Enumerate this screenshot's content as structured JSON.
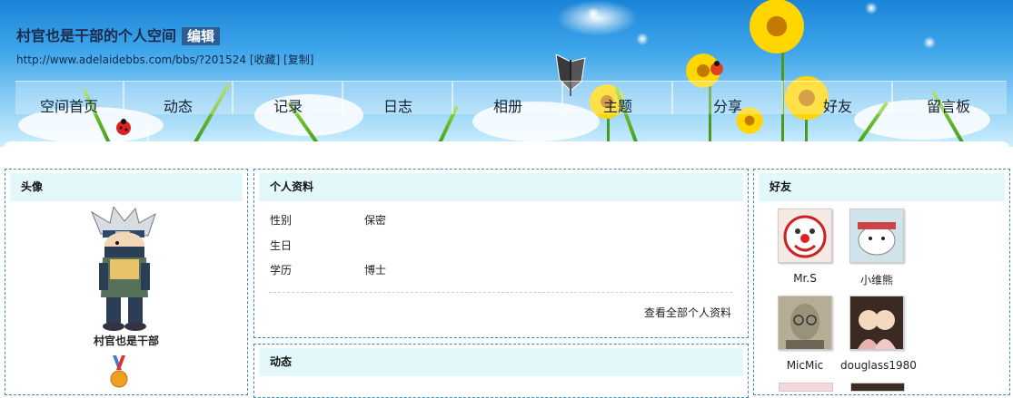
{
  "header": {
    "space_title": "村官也是干部的个人空间",
    "edit_label": "编辑",
    "url": "http://www.adelaidebbs.com/bbs/?201524",
    "favorite_label": "[收藏]",
    "copy_label": "[复制]"
  },
  "nav": {
    "items": [
      "空间首页",
      "动态",
      "记录",
      "日志",
      "相册",
      "主题",
      "分享",
      "好友",
      "留言板"
    ],
    "second_row": "个人资料"
  },
  "avatar_panel": {
    "title": "头像",
    "username": "村官也是干部"
  },
  "profile_panel": {
    "title": "个人资料",
    "rows": [
      {
        "label": "性别",
        "value": "保密"
      },
      {
        "label": "生日",
        "value": ""
      },
      {
        "label": "学历",
        "value": "博士"
      }
    ],
    "view_all": "查看全部个人资料"
  },
  "feed_panel": {
    "title": "动态"
  },
  "friends_panel": {
    "title": "好友",
    "friends": [
      {
        "name": "Mr.S"
      },
      {
        "name": "小维熊"
      },
      {
        "name": "MicMic"
      },
      {
        "name": "douglass1980"
      }
    ]
  },
  "colors": {
    "panel_header_bg": "#e3f8fb",
    "panel_border": "#3a8fb0",
    "edit_button_bg": "#2e5d94"
  }
}
